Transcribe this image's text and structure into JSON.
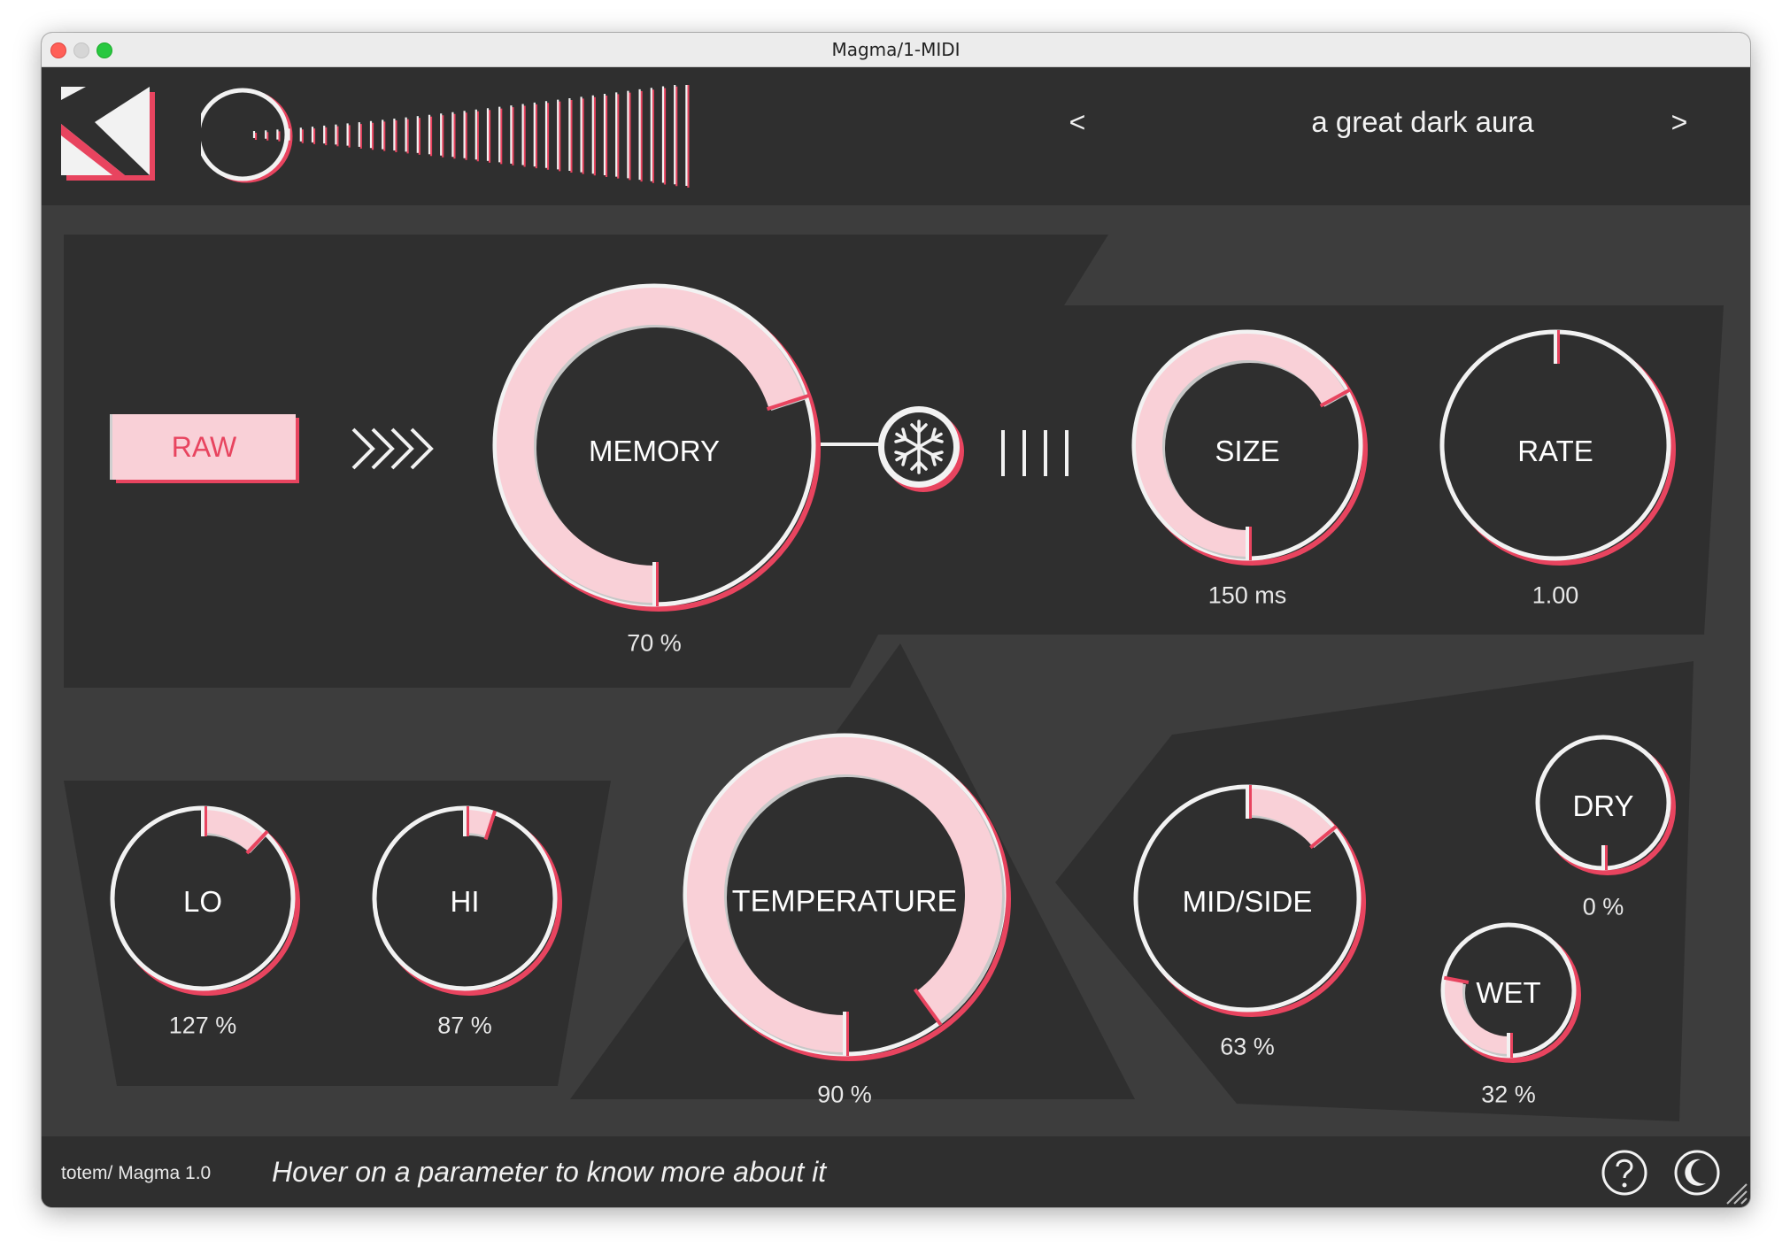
{
  "window": {
    "title": "Magma/1-MIDI"
  },
  "header": {
    "preset_name": "a great dark aura",
    "prev_label": "<",
    "next_label": ">"
  },
  "controls": {
    "raw_label": "RAW"
  },
  "knobs": {
    "memory": {
      "label": "MEMORY",
      "value_text": "70 %",
      "fraction": 0.7
    },
    "size": {
      "label": "SIZE",
      "value_text": "150 ms",
      "fraction": 0.67
    },
    "rate": {
      "label": "RATE",
      "value_text": "1.00",
      "fraction": 0.0
    },
    "lo": {
      "label": "LO",
      "value_text": "127 %",
      "fraction": 0.12
    },
    "hi": {
      "label": "HI",
      "value_text": "87 %",
      "fraction": 0.05
    },
    "temperature": {
      "label": "TEMPERATURE",
      "value_text": "90 %",
      "fraction": 0.9
    },
    "mid_side": {
      "label": "MID/SIDE",
      "value_text": "63 %",
      "fraction": 0.14
    },
    "dry": {
      "label": "DRY",
      "value_text": "0 %",
      "fraction": 0.0
    },
    "wet": {
      "label": "WET",
      "value_text": "32 %",
      "fraction": 0.28
    }
  },
  "footer": {
    "version": "totem/ Magma 1.0",
    "hint": "Hover on a parameter to know more about it"
  },
  "colors": {
    "accent": "#e8445f",
    "fill": "#f9d0d7",
    "panel": "#2f2f2f",
    "background": "#3d3d3d",
    "text": "#ffffff"
  },
  "icons": [
    "logo-icon",
    "input-meter-icon",
    "chevron-icon",
    "snowflake-icon",
    "bars-icon",
    "help-icon",
    "moon-icon",
    "resize-grip-icon"
  ]
}
